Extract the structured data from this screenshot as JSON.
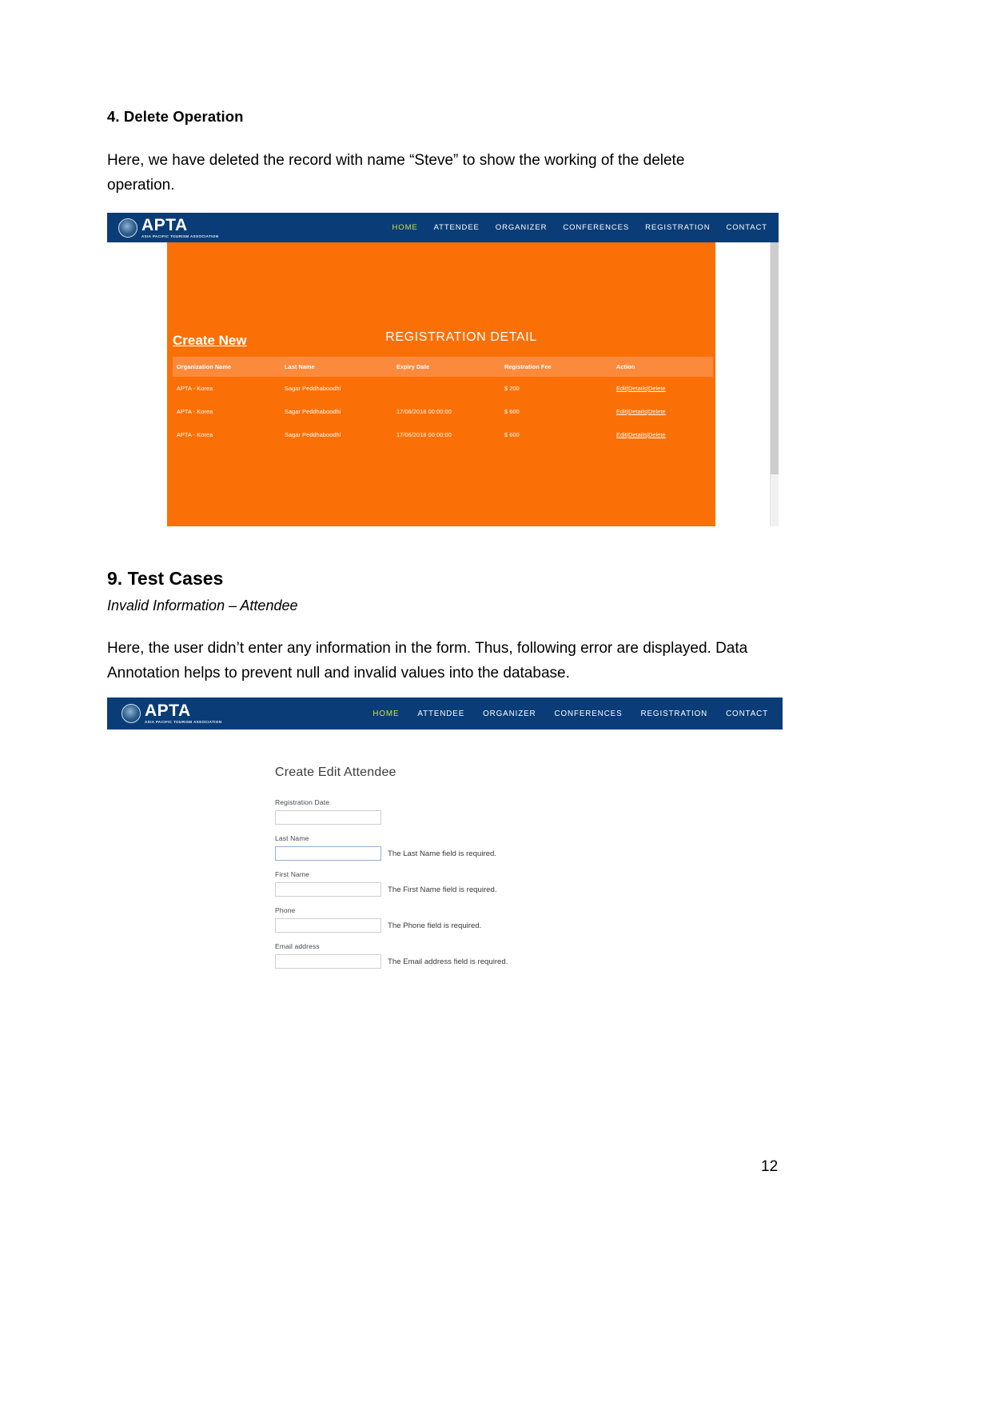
{
  "document": {
    "section_heading": "4. Delete Operation",
    "paragraph_1": "Here, we have deleted the record with name “Steve” to show the working of the delete operation.",
    "section_heading_2": "9. Test Cases",
    "subheading_italic": "Invalid Information – Attendee",
    "paragraph_2": "Here, the user didn’t enter any information in the form. Thus, following error are displayed. Data Annotation helps to prevent null and invalid values into the database.",
    "page_number": "12"
  },
  "brand": {
    "name": "APTA",
    "tagline": "ASIA PACIFIC TOURISM ASSOCIATION",
    "navbar_color": "#0a3d77",
    "active_link_color": "#cfe04c"
  },
  "nav": {
    "items": [
      {
        "label": "HOME",
        "active": true
      },
      {
        "label": "ATTENDEE",
        "active": false
      },
      {
        "label": "ORGANIZER",
        "active": false
      },
      {
        "label": "CONFERENCES",
        "active": false
      },
      {
        "label": "REGISTRATION",
        "active": false
      },
      {
        "label": "CONTACT",
        "active": false
      }
    ]
  },
  "screenshot_registration": {
    "accent_color": "#fb7006",
    "header_row_color": "#fb8a3d",
    "create_new_label": "Create New",
    "page_title": "REGISTRATION DETAIL",
    "table": {
      "columns": [
        "Organization Name",
        "Last Name",
        "Expiry Date",
        "Registration Fee",
        "Action"
      ],
      "rows": [
        {
          "organization_name": "APTA - Korea",
          "last_name": "Sagar Peddhaboodhi",
          "expiry_date": "",
          "registration_fee": "$ 200",
          "actions": [
            "Edit",
            "Details",
            "Delete"
          ]
        },
        {
          "organization_name": "APTA - Korea",
          "last_name": "Sagar Peddhaboodhi",
          "expiry_date": "17/06/2018 00:00:00",
          "registration_fee": "$ 600",
          "actions": [
            "Edit",
            "Details",
            "Delete"
          ]
        },
        {
          "organization_name": "APTA - Korea",
          "last_name": "Sagar Peddhaboodhi",
          "expiry_date": "17/06/2018 00:00:00",
          "registration_fee": "$ 600",
          "actions": [
            "Edit",
            "Details",
            "Delete"
          ]
        }
      ],
      "action_separator": "|"
    }
  },
  "screenshot_attendee_form": {
    "form_title": "Create Edit Attendee",
    "fields": [
      {
        "label": "Registration Date",
        "value": "",
        "error": "",
        "focused": false
      },
      {
        "label": "Last Name",
        "value": "",
        "error": "The Last Name field is required.",
        "focused": true
      },
      {
        "label": "First Name",
        "value": "",
        "error": "The First Name field is required.",
        "focused": false
      },
      {
        "label": "Phone",
        "value": "",
        "error": "The Phone field is required.",
        "focused": false
      },
      {
        "label": "Email address",
        "value": "",
        "error": "The Email address field is required.",
        "focused": false
      }
    ]
  }
}
